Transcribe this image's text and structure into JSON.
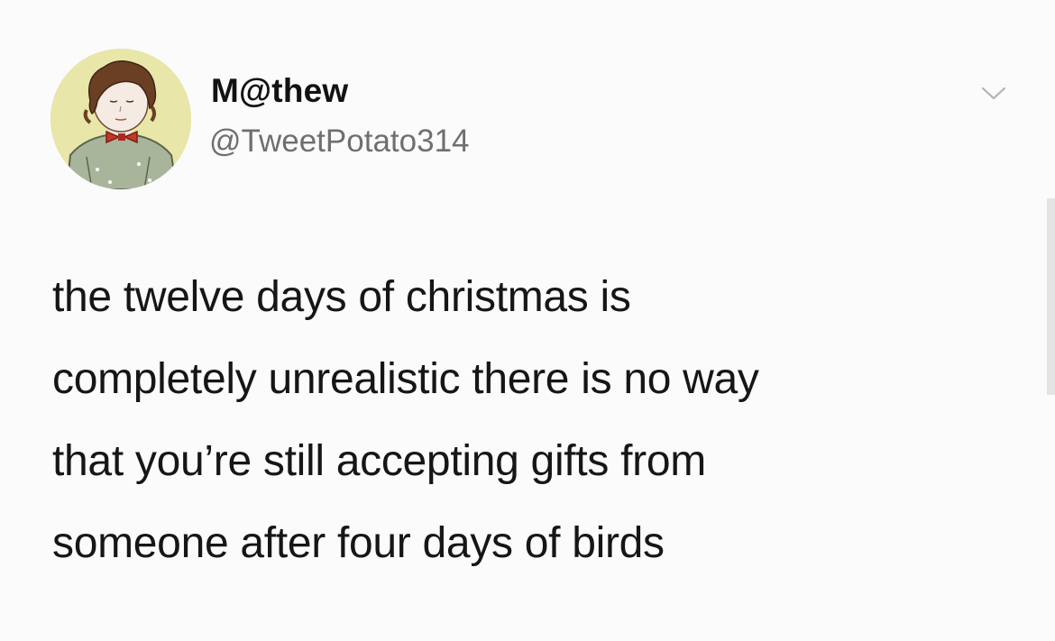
{
  "tweet": {
    "author": {
      "display_name": "M@thew",
      "handle": "@TweetPotato314"
    },
    "text_lines": [
      "the twelve days of christmas is",
      "completely unrealistic there is no way",
      "that you’re still accepting gifts from",
      "someone after four days of birds"
    ],
    "menu_icon": "chevron-down-icon",
    "avatar_icon": "avatar"
  },
  "colors": {
    "background": "#fbfbfb",
    "name": "#121212",
    "handle": "#6f6f6f",
    "avatar_bg": "#e8e6a8",
    "bow_tie": "#c8352b"
  }
}
